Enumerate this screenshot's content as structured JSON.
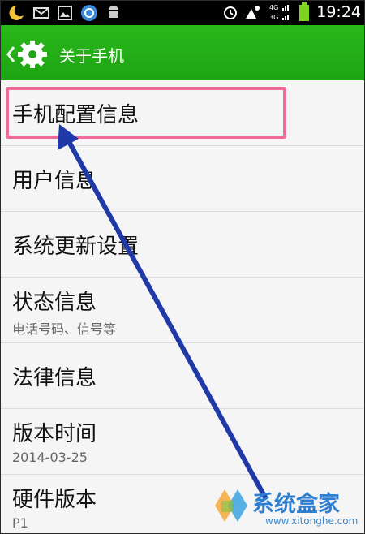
{
  "status_bar": {
    "time": "19:24",
    "left_icons": [
      "moon-icon",
      "mail-icon",
      "gallery-icon",
      "usb-debug-icon",
      "android-icon"
    ],
    "right_icons": [
      "alarm-icon",
      "weather-icon",
      "signal-icon",
      "battery-icon"
    ],
    "network_labels": [
      "4G",
      "3G"
    ]
  },
  "action_bar": {
    "title": "关于手机",
    "accent_color": "#1ea414"
  },
  "list": {
    "items": [
      {
        "label": "手机配置信息",
        "sublabel": ""
      },
      {
        "label": "用户信息",
        "sublabel": ""
      },
      {
        "label": "系统更新设置",
        "sublabel": ""
      },
      {
        "label": "状态信息",
        "sublabel": "电话号码、信号等"
      },
      {
        "label": "法律信息",
        "sublabel": ""
      },
      {
        "label": "版本时间",
        "sublabel": "2014-03-25"
      },
      {
        "label": "硬件版本",
        "sublabel": "P1"
      }
    ]
  },
  "annotation": {
    "highlight_color": "#ef6b9a",
    "arrow_color": "#1f3aa8"
  },
  "watermark": {
    "text": "系统盒家",
    "url": "www.xitonghe.com"
  }
}
